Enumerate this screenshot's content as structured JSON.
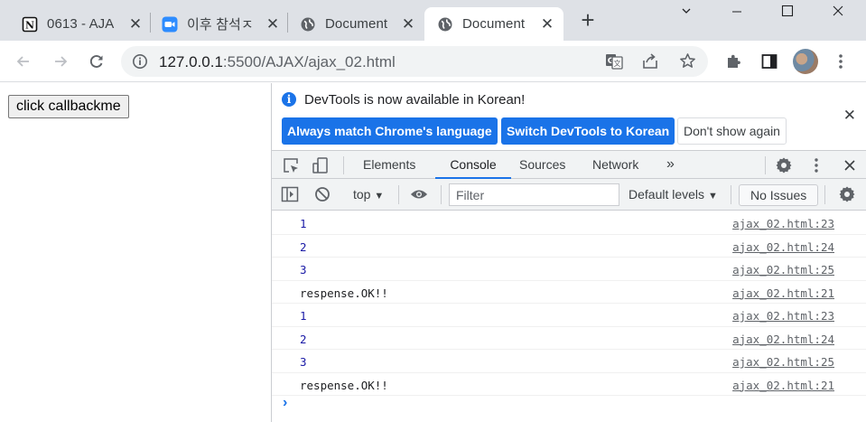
{
  "tabs": [
    {
      "title": "0613 - AJA",
      "icon": "notion-icon"
    },
    {
      "title": "이후 참석ㅈ",
      "icon": "zoom-icon"
    },
    {
      "title": "Document",
      "icon": "globe-icon"
    },
    {
      "title": "Document",
      "icon": "globe-icon",
      "active": true
    }
  ],
  "toolbar": {
    "url_host": "127.0.0.1",
    "url_rest": ":5500/AJAX/ajax_02.html"
  },
  "page": {
    "button_label": "click callbackme"
  },
  "devtools": {
    "infobar": {
      "message": "DevTools is now available in Korean!",
      "btn_match": "Always match Chrome's language",
      "btn_switch": "Switch DevTools to Korean",
      "btn_dismiss": "Don't show again"
    },
    "panels": [
      "Elements",
      "Console",
      "Sources",
      "Network"
    ],
    "active_panel": "Console",
    "console_toolbar": {
      "context": "top",
      "filter_placeholder": "Filter",
      "levels": "Default levels",
      "issues": "No Issues"
    },
    "logs": [
      {
        "message": "1",
        "type": "number",
        "source": "ajax_02.html:23"
      },
      {
        "message": "2",
        "type": "number",
        "source": "ajax_02.html:24"
      },
      {
        "message": "3",
        "type": "number",
        "source": "ajax_02.html:25"
      },
      {
        "message": "respense.OK!!",
        "type": "string",
        "source": "ajax_02.html:21"
      },
      {
        "message": "1",
        "type": "number",
        "source": "ajax_02.html:23"
      },
      {
        "message": "2",
        "type": "number",
        "source": "ajax_02.html:24"
      },
      {
        "message": "3",
        "type": "number",
        "source": "ajax_02.html:25"
      },
      {
        "message": "respense.OK!!",
        "type": "string",
        "source": "ajax_02.html:21"
      }
    ],
    "prompt_symbol": "›"
  },
  "colors": {
    "accent": "#1a73e8",
    "tabstrip": "#dee1e6",
    "number_log": "#1a1aa6"
  }
}
